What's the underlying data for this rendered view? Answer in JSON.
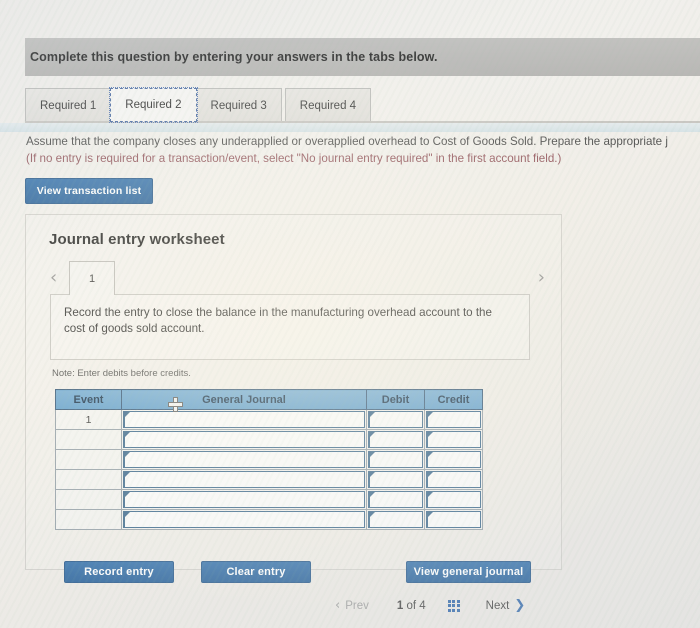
{
  "header": {
    "instruction_band": "Complete this question by entering your answers in the tabs below."
  },
  "tabs": [
    {
      "label": "Required 1",
      "active": false
    },
    {
      "label": "Required 2",
      "active": true
    },
    {
      "label": "Required 3",
      "active": false
    },
    {
      "label": "Required 4",
      "active": false
    }
  ],
  "instructions": {
    "line1": "Assume that the company closes any underapplied or overapplied overhead to Cost of Goods Sold. Prepare the appropriate j",
    "line2": "(If no entry is required for a transaction/event, select \"No journal entry required\" in the first account field.)"
  },
  "toolbar": {
    "view_transaction_list": "View transaction list"
  },
  "worksheet": {
    "title": "Journal entry worksheet",
    "prev_icon": "chevron-left-icon",
    "next_icon": "chevron-right-icon",
    "entry_tab": "1",
    "description": "Record the entry to close the balance in the manufacturing overhead account to the cost of goods sold account.",
    "note": "Note: Enter debits before credits.",
    "table": {
      "columns": [
        "Event",
        "General Journal",
        "Debit",
        "Credit"
      ],
      "rows": [
        {
          "event": "1",
          "journal": "",
          "debit": "",
          "credit": ""
        },
        {
          "event": "",
          "journal": "",
          "debit": "",
          "credit": ""
        },
        {
          "event": "",
          "journal": "",
          "debit": "",
          "credit": ""
        },
        {
          "event": "",
          "journal": "",
          "debit": "",
          "credit": ""
        },
        {
          "event": "",
          "journal": "",
          "debit": "",
          "credit": ""
        },
        {
          "event": "",
          "journal": "",
          "debit": "",
          "credit": ""
        }
      ]
    },
    "buttons": {
      "record_entry": "Record entry",
      "clear_entry": "Clear entry",
      "view_general_journal": "View general journal"
    }
  },
  "pagination": {
    "prev_label": "Prev",
    "prev_icon": "chevron-left-icon",
    "counter_current": "1",
    "counter_of": "of",
    "counter_total": "4",
    "grid_icon": "grid-view-icon",
    "next_label": "Next",
    "next_icon": "chevron-right-icon"
  },
  "colors": {
    "primary_button": "#1e5a96",
    "table_header": "#5a9bcb",
    "accent_link": "#2a62a8",
    "warning_text": "#8b4a52"
  }
}
